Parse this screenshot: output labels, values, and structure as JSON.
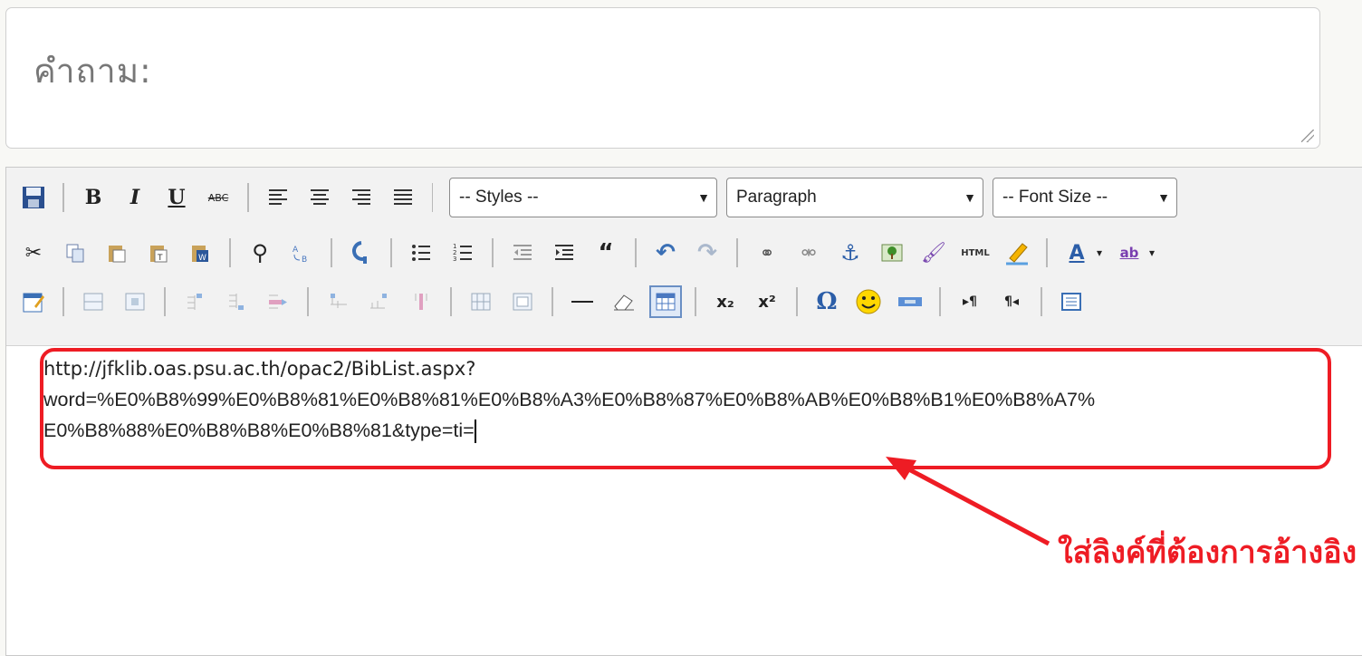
{
  "question": {
    "placeholder": "คำถาม:"
  },
  "toolbar": {
    "styles_select": "-- Styles --",
    "format_select": "Paragraph",
    "font_size_select": "-- Font Size --",
    "bold": "B",
    "italic": "I",
    "underline": "U",
    "strike": "ABC",
    "html_label": "HTML",
    "subscript": "x₂",
    "superscript": "x²",
    "omega": "Ω",
    "font_color": "A",
    "highlight": "ab"
  },
  "editor": {
    "line1": "http://jfklib.oas.psu.ac.th/opac2/BibList.aspx?",
    "line2": "word=%E0%B8%99%E0%B8%81%E0%B8%81%E0%B8%A3%E0%B8%87%E0%B8%AB%E0%B8%B1%E0%B8%A7%",
    "line3": "E0%B8%88%E0%B8%B8%E0%B8%81&type=ti="
  },
  "annotation": {
    "text": "ใส่ลิงค์ที่ต้องการอ้างอิง",
    "color": "#ee1c24"
  }
}
